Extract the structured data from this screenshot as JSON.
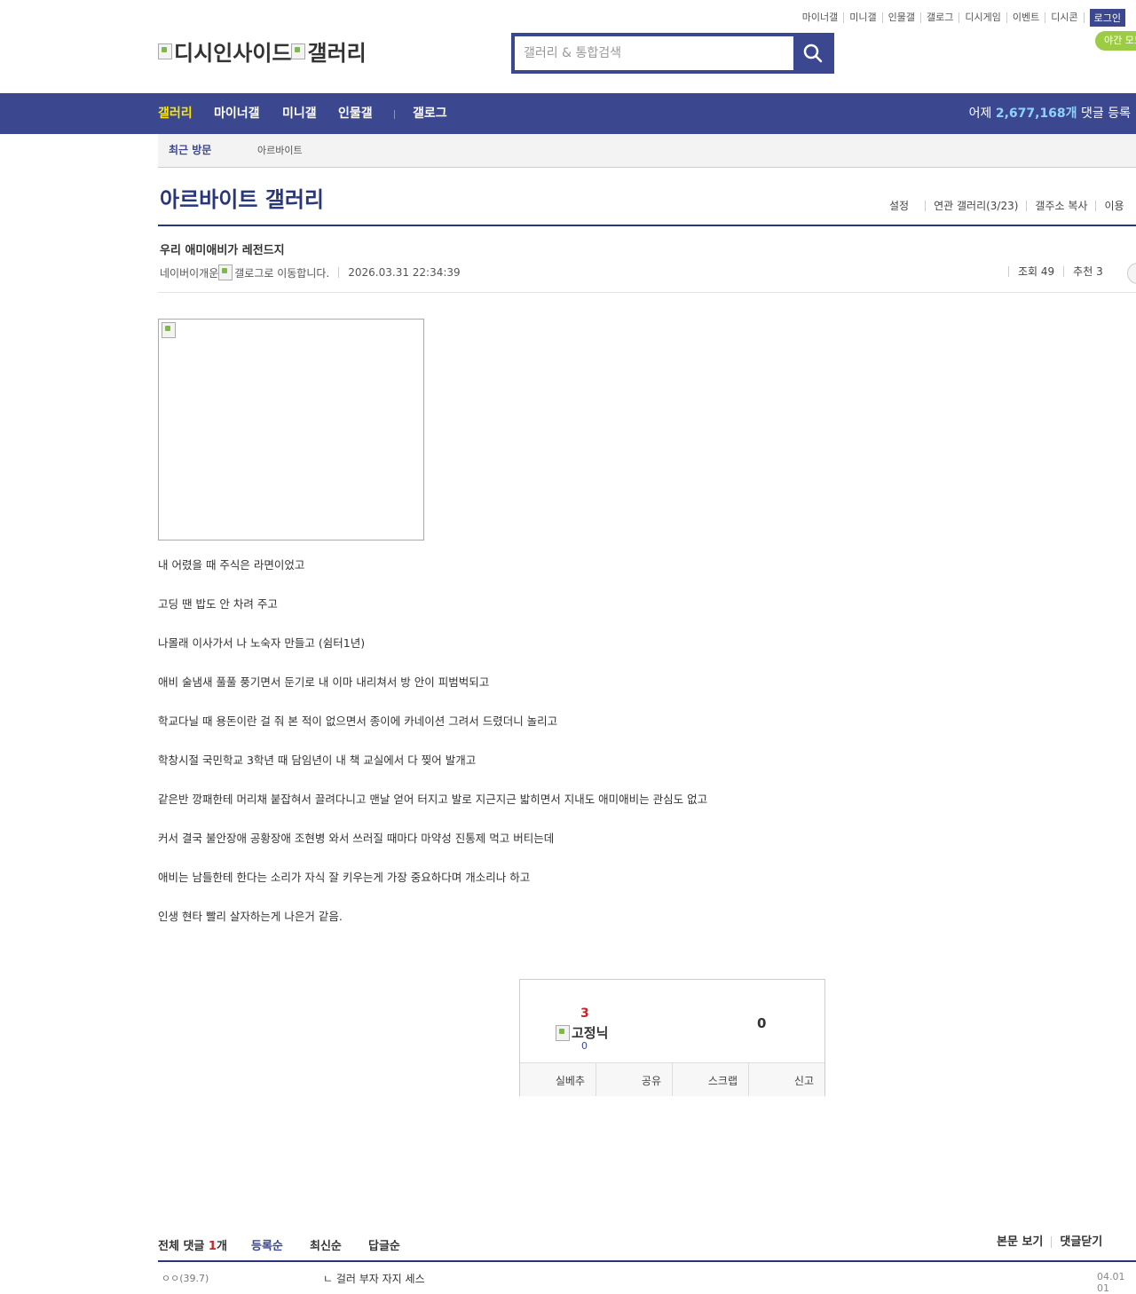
{
  "topnav": {
    "links": [
      "마이너갤",
      "미니갤",
      "인물갤",
      "갤로그",
      "디시게임",
      "이벤트",
      "디시콘"
    ],
    "login": "로그인",
    "night_mode": "야간 모드"
  },
  "logo": {
    "site": "디시인사이드",
    "section": "갤러리"
  },
  "search": {
    "placeholder": "갤러리 & 통합검색"
  },
  "navbar": {
    "items": [
      "갤러리",
      "마이너갤",
      "미니갤",
      "인물갤",
      "갤로그"
    ],
    "stat_prefix": "어제",
    "stat_count": "2,677,168개",
    "stat_suffix": "댓글 등록"
  },
  "recent": {
    "title": "최근 방문",
    "galleries": [
      "아르바이트"
    ]
  },
  "gallery": {
    "title": "아르바이트 갤러리",
    "links": [
      "설정",
      "연관 갤러리(3/23)",
      "갤주소 복사",
      "이용"
    ]
  },
  "post": {
    "title": "우리 애미애비가 레전드지",
    "author": "네이버이개운",
    "galog_alt": "갤로그로 이동합니다.",
    "date": "2026.03.31 22:34:39",
    "views_label": "조회 49",
    "recommend_label": "추천 3",
    "body": [
      "내 어렸을 때 주식은 라면이었고",
      "고딩 땐 밥도 안 차려 주고",
      "나몰래 이사가서 나 노숙자 만들고 (쉼터1년)",
      "애비 술냄새 풀풀 풍기면서 둔기로 내 이마 내리쳐서 방 안이 피범벅되고",
      "학교다닐 때 용돈이란 걸 줘 본 적이 없으면서 종이에 카네이션 그려서 드렸더니 놀리고",
      "학창시절 국민학교 3학년 때 담임년이 내 책 교실에서 다 찢어 발개고",
      "같은반 깡패한테 머리채 붙잡혀서 끌려다니고 맨날 얻어 터지고 발로 지근지근 밟히면서 지내도 애미애비는 관심도 없고",
      "커서 결국 불안장애 공황장애 조현병 와서 쓰러질 때마다 마약성 진통제 먹고 버티는데",
      "애비는 남들한테 한다는 소리가 자식 잘 키우는게 가장 중요하다며 개소리나 하고",
      "인생 현타 빨리 살자하는게 나은거 같음."
    ]
  },
  "recommend": {
    "up_count": "3",
    "fixed_nick_alt": "고정닉",
    "fixed_count": "0",
    "down_count": "0",
    "buttons": [
      "실베추",
      "공유",
      "스크랩",
      "신고"
    ]
  },
  "comments": {
    "total_label": "전체 댓글",
    "total_count": "1",
    "total_unit": "개",
    "sorts": [
      "등록순",
      "최신순",
      "답글순"
    ],
    "actions": [
      "본문 보기",
      "댓글닫기"
    ],
    "first": {
      "nick": "ㅇㅇ(39.7)",
      "text": "ㄴ 걸러 부자 자지 세스",
      "time": "04.01 01"
    }
  }
}
